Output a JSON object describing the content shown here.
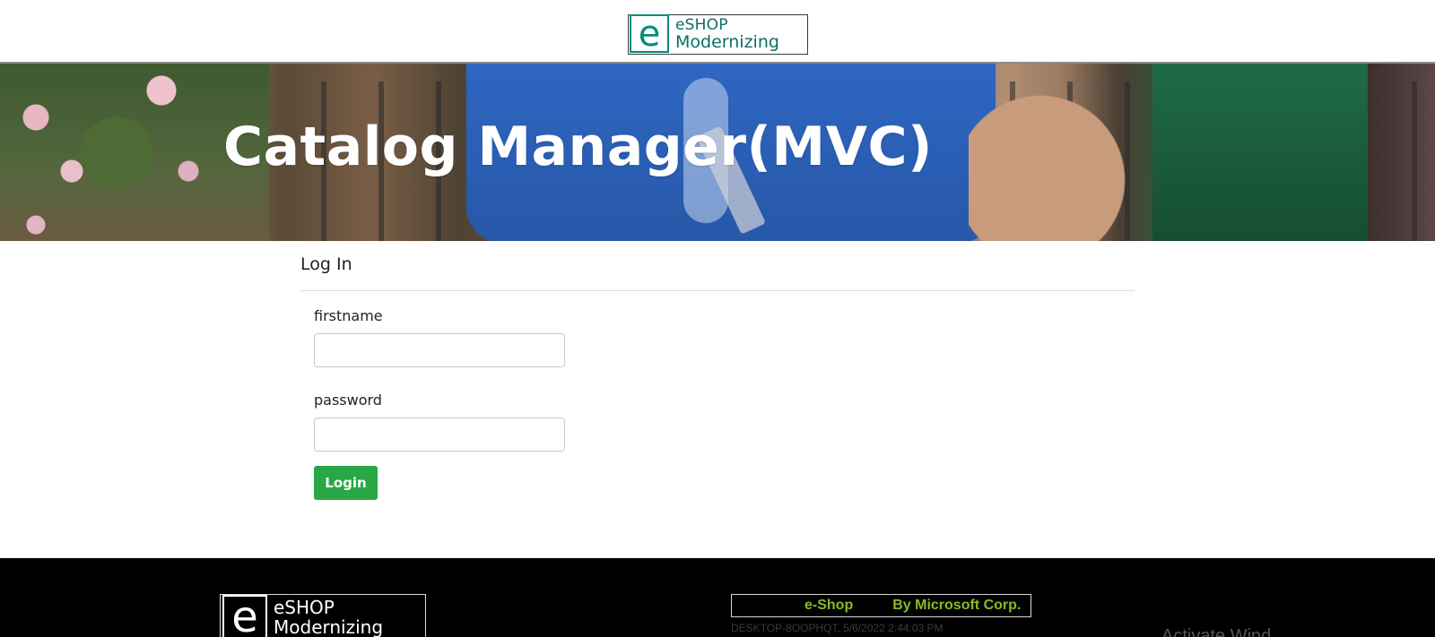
{
  "header": {
    "brand_icon": "e",
    "brand_line1": "eSHOP",
    "brand_line2": "Modernizing"
  },
  "hero": {
    "title": "Catalog Manager(MVC)"
  },
  "login": {
    "heading": "Log In",
    "firstname_label": "firstname",
    "firstname_value": "",
    "password_label": "password",
    "password_value": "",
    "submit_label": "Login"
  },
  "footer": {
    "brand_icon": "e",
    "brand_line1": "eSHOP",
    "brand_line2": "Modernizing",
    "credits_left": "e-Shop",
    "credits_right": "By Microsoft Corp.",
    "server_info": "DESKTOP-8OOPHQT, 5/6/2022 2:44:03 PM",
    "watermark": "Activate Wind"
  },
  "colors": {
    "brand_teal": "#0d8a7c",
    "login_button": "#28a745",
    "footer_bg": "#000000",
    "credits_green": "#86bc25"
  }
}
